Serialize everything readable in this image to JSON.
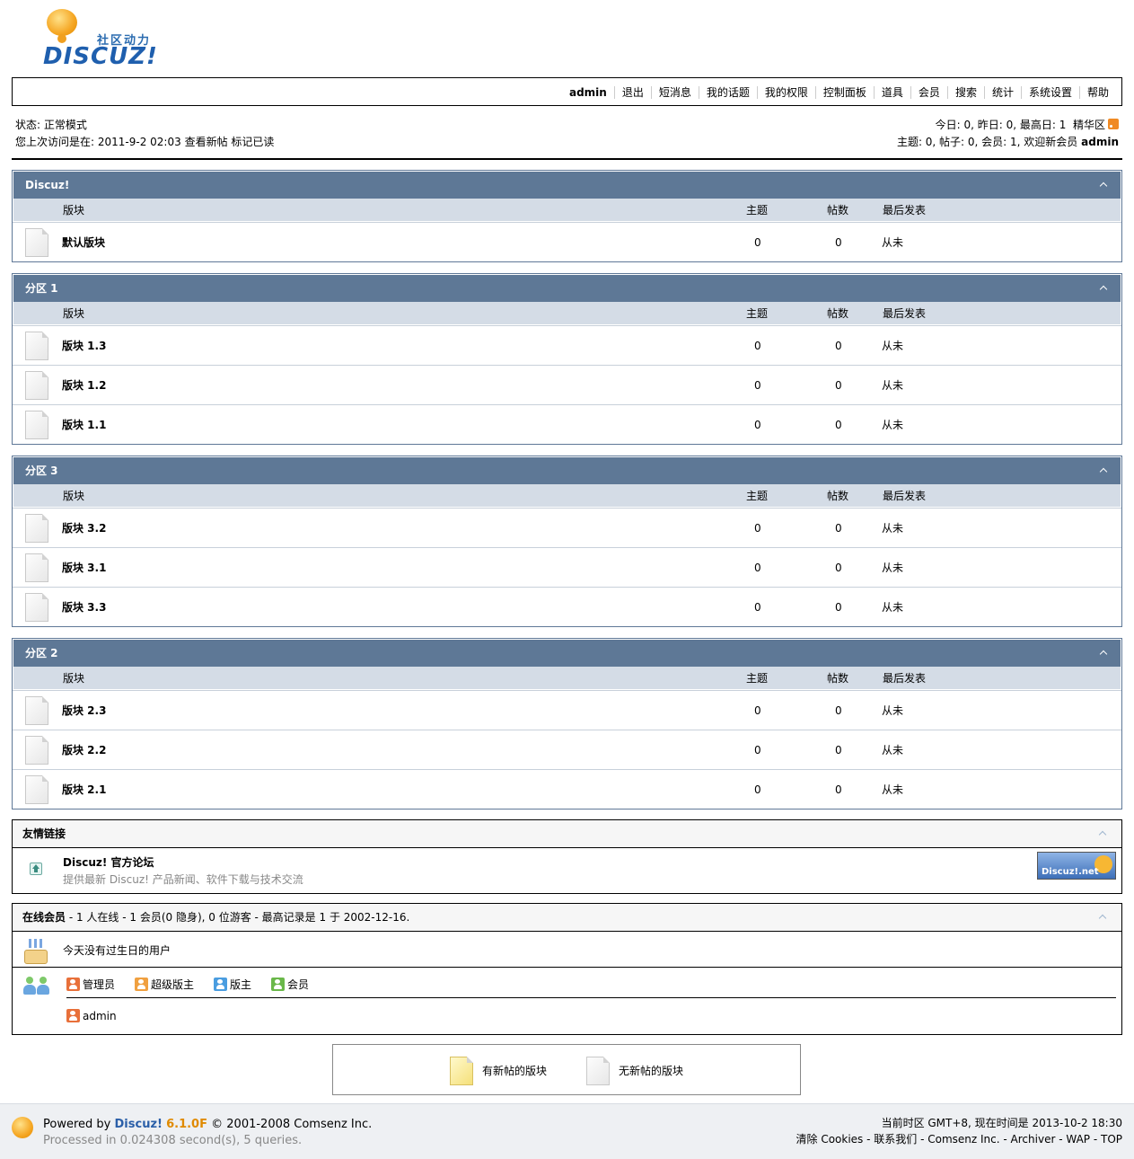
{
  "logo": {
    "cn": "社区动力",
    "en": "DISCUZ!"
  },
  "menu": [
    "admin",
    "退出",
    "短消息",
    "我的话题",
    "我的权限",
    "控制面板",
    "道具",
    "会员",
    "搜索",
    "统计",
    "系统设置",
    "帮助"
  ],
  "status": {
    "mode_label": "状态:",
    "mode_value": "正常模式",
    "last_visit_label": "您上次访问是在:",
    "last_visit_time": "2011-9-2 02:03",
    "view_new": "查看新帖",
    "mark_read": "标记已读",
    "stats_line1": "今日: 0, 昨日: 0, 最高日: 1",
    "digest": "精华区",
    "stats_line2": "主题: 0, 帖子: 0, 会员: 1, 欢迎新会员",
    "new_member": "admin"
  },
  "columns": {
    "forum": "版块",
    "threads": "主题",
    "posts": "帖数",
    "lastpost": "最后发表"
  },
  "categories": [
    {
      "name": "Discuz!",
      "forums": [
        {
          "name": "默认版块",
          "threads": "0",
          "posts": "0",
          "last": "从未"
        }
      ]
    },
    {
      "name": "分区 1",
      "forums": [
        {
          "name": "版块 1.3",
          "threads": "0",
          "posts": "0",
          "last": "从未"
        },
        {
          "name": "版块 1.2",
          "threads": "0",
          "posts": "0",
          "last": "从未"
        },
        {
          "name": "版块 1.1",
          "threads": "0",
          "posts": "0",
          "last": "从未"
        }
      ]
    },
    {
      "name": "分区 3",
      "forums": [
        {
          "name": "版块 3.2",
          "threads": "0",
          "posts": "0",
          "last": "从未"
        },
        {
          "name": "版块 3.1",
          "threads": "0",
          "posts": "0",
          "last": "从未"
        },
        {
          "name": "版块 3.3",
          "threads": "0",
          "posts": "0",
          "last": "从未"
        }
      ]
    },
    {
      "name": "分区 2",
      "forums": [
        {
          "name": "版块 2.3",
          "threads": "0",
          "posts": "0",
          "last": "从未"
        },
        {
          "name": "版块 2.2",
          "threads": "0",
          "posts": "0",
          "last": "从未"
        },
        {
          "name": "版块 2.1",
          "threads": "0",
          "posts": "0",
          "last": "从未"
        }
      ]
    }
  ],
  "links": {
    "title": "友情链接",
    "site_name": "Discuz! 官方论坛",
    "site_desc": "提供最新 Discuz! 产品新闻、软件下载与技术交流",
    "banner_text": "Discuz!.net"
  },
  "online": {
    "title": "在线会员",
    "summary": " - 1 人在线 - 1 会员(0 隐身), 0 位游客 - 最高记录是 1 于 2002-12-16.",
    "birthday": "今天没有过生日的用户",
    "legend": [
      {
        "label": "管理员",
        "color": "#e8703a"
      },
      {
        "label": "超级版主",
        "color": "#f0a040"
      },
      {
        "label": "版主",
        "color": "#4a9de0"
      },
      {
        "label": "会员",
        "color": "#6ab84a"
      }
    ],
    "users": [
      {
        "name": "admin",
        "color": "#e8703a"
      }
    ]
  },
  "icon_legend": {
    "new": "有新帖的版块",
    "none": "无新帖的版块"
  },
  "footer": {
    "powered": "Powered by",
    "brand": "Discuz!",
    "version": "6.1.0F",
    "copyright": "© 2001-2008 Comsenz Inc.",
    "processed": "Processed in 0.024308 second(s), 5 queries.",
    "timezone": "当前时区 GMT+8, 现在时间是 2013-10-2 18:30",
    "links": [
      "清除 Cookies",
      "联系我们",
      "Comsenz Inc.",
      "Archiver",
      "WAP",
      "TOP"
    ]
  }
}
